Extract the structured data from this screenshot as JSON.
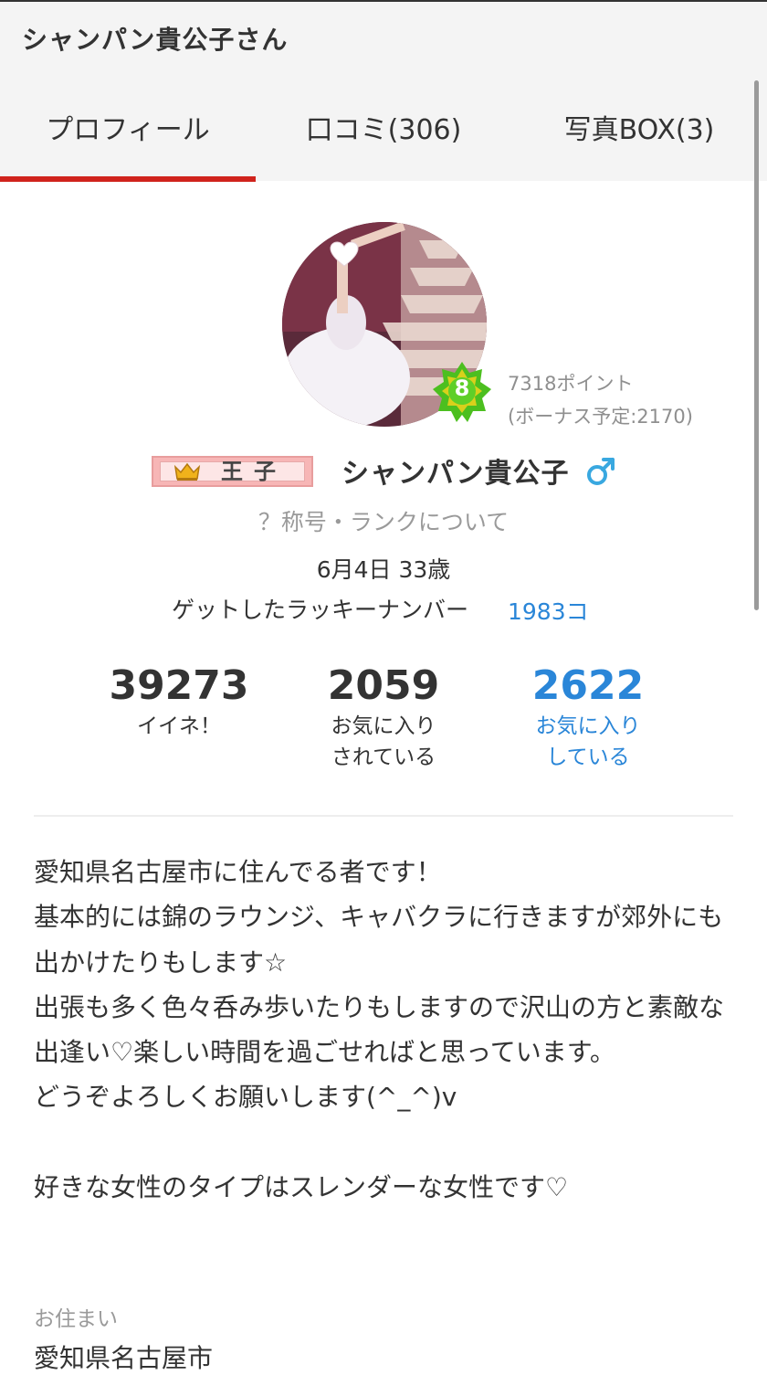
{
  "header": {
    "title": "シャンパン貴公子さん",
    "tabs": [
      {
        "label": "プロフィール",
        "active": true
      },
      {
        "label": "口コミ(306)",
        "active": false
      },
      {
        "label": "写真BOX(3)",
        "active": false
      }
    ],
    "accent_color": "#d0231c"
  },
  "profile": {
    "avatar_icon": "avatar-photo",
    "rank_level": "8",
    "points": "7318ポイント",
    "bonus": "(ボーナス予定:2170)",
    "title_badge": "王子",
    "username": "シャンパン貴公子",
    "gender_symbol": "♂",
    "rank_help_link": "？称号・ランクについて",
    "birthday_age": "6月4日 33歳",
    "lucky_number_label": "ゲットしたラッキーナンバー",
    "lucky_number_value": "1983コ"
  },
  "stats": [
    {
      "value": "39273",
      "label": "イイネ！"
    },
    {
      "value": "2059",
      "label": "お気に入り\nされている"
    },
    {
      "value": "2622",
      "label": "お気に入り\nしている"
    }
  ],
  "bio": "愛知県名古屋市に住んでる者です！\n基本的には錦のラウンジ、キャバクラに行きますが郊外にも出かけたりもします☆\n出張も多く色々呑み歩いたりもしますので沢山の方と素敵な出逢い♡楽しい時間を過ごせればと思っています。\nどうぞよろしくお願いします(^_^)v\n\n好きな女性のタイプはスレンダーな女性です♡",
  "residence": {
    "label": "お住まい",
    "value": "愛知県名古屋市"
  },
  "colors": {
    "link_blue": "#2a86d8",
    "rank_green": "#4cbf1f",
    "gender_blue": "#39a8e0"
  }
}
